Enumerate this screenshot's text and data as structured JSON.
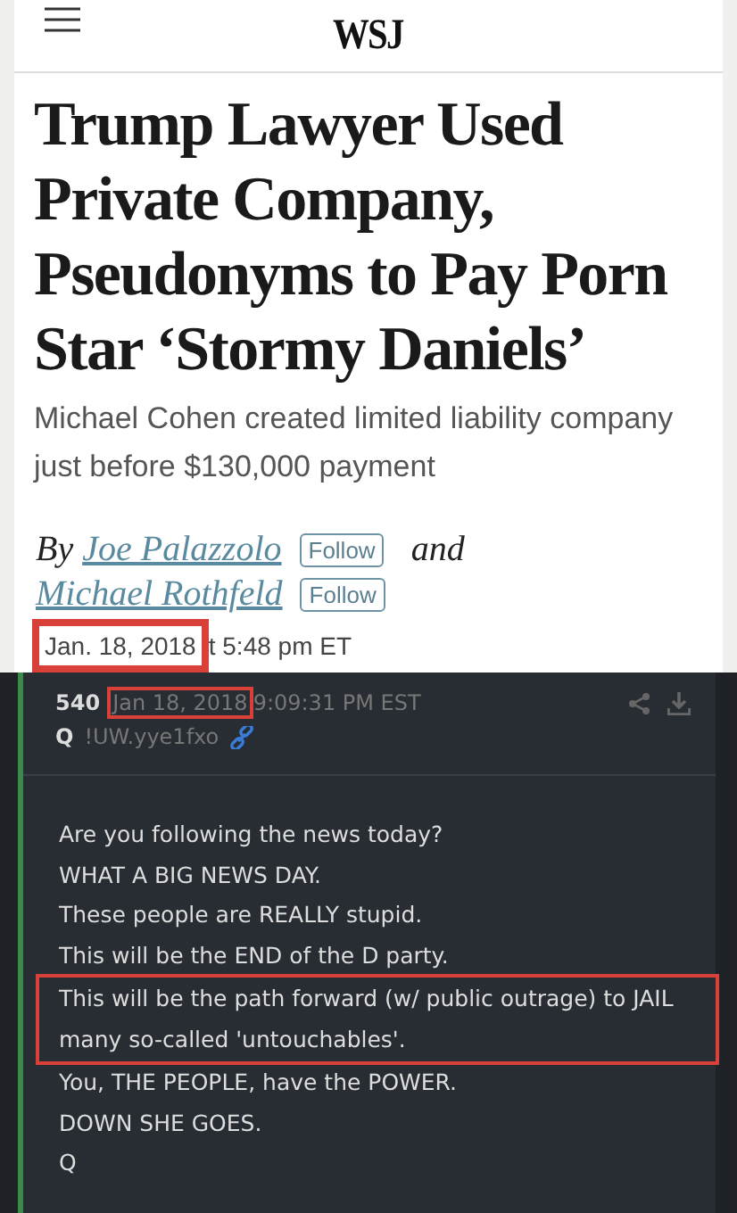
{
  "article": {
    "logo": "WSJ",
    "headline": "Trump Lawyer Used Private Company, Pseudonyms to Pay Porn Star ‘Stormy Daniels’",
    "subtitle": "Michael Cohen created limited liability company just before $130,000 payment",
    "byline": {
      "prefix": "By",
      "authors": [
        {
          "name": "Joe Palazzolo",
          "follow": "Follow"
        },
        {
          "name": "Michael Rothfeld",
          "follow": "Follow"
        }
      ],
      "joiner": "and"
    },
    "date": {
      "text": "Jan. 18, 2018",
      "highlighted": true
    },
    "time": "t 5:48 pm ET"
  },
  "post": {
    "number": "540",
    "date": {
      "text": "Jan 18, 2018",
      "highlighted": true
    },
    "time": "9:09:31 PM EST",
    "author": "Q",
    "tripcode": "!UW.yye1fxo",
    "blocks": [
      {
        "lines": [
          "Are you following the news today?",
          "WHAT A BIG NEWS DAY.",
          "These people are REALLY stupid.",
          "This will be the END of the D party."
        ],
        "highlighted": false
      },
      {
        "lines": [
          "This will be the path forward (w/ public outrage) to JAIL",
          "many so-called 'untouchables'."
        ],
        "highlighted": true
      },
      {
        "lines": [
          "You, THE PEOPLE, have the POWER.",
          "DOWN SHE GOES.",
          "Q"
        ],
        "highlighted": false
      }
    ]
  }
}
